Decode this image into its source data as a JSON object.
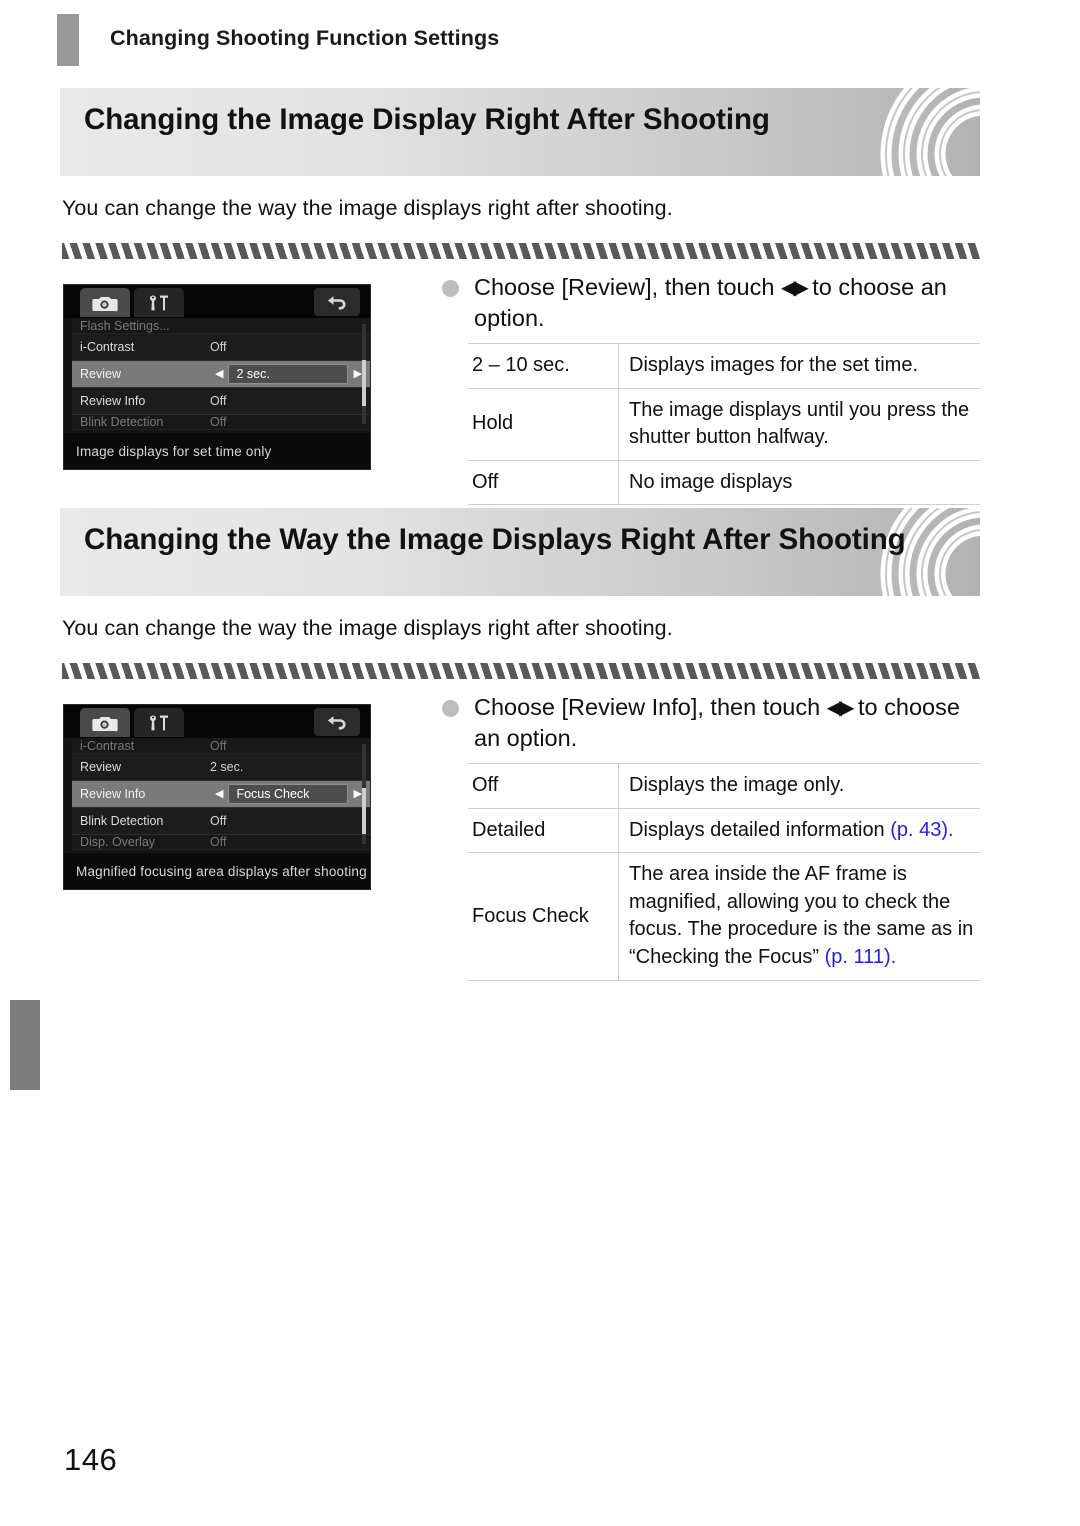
{
  "running_header": {
    "title": "Changing Shooting Function Settings"
  },
  "folio": "146",
  "sections": [
    {
      "band_title": "Changing the Image Display Right After Shooting",
      "intro": "You can change the way the image displays right after shooting.",
      "instruction": {
        "prefix": "Choose [Review], then touch",
        "arrows": "◀▶",
        "suffix": "to choose an option."
      },
      "lcd": {
        "tab_camera_icon": "camera-icon",
        "tab_settings_icon": "wrench-tools-icon",
        "back_icon": "return-arrow-icon",
        "caption": "Image displays for set time only",
        "rows": [
          {
            "label": "Flash Settings...",
            "value": "",
            "state": "clipped"
          },
          {
            "label": "i-Contrast",
            "value": "Off",
            "state": "normal"
          },
          {
            "label": "Review",
            "value": "2 sec.",
            "state": "selected"
          },
          {
            "label": "Review Info",
            "value": "Off",
            "state": "normal"
          },
          {
            "label": "Blink Detection",
            "value": "Off",
            "state": "clipped"
          }
        ]
      },
      "table": {
        "rows": [
          {
            "key": "2 – 10 sec.",
            "value": "Displays images for the set time.",
            "pageref": ""
          },
          {
            "key": "Hold",
            "value": "The image displays until you press the shutter button halfway.",
            "pageref": ""
          },
          {
            "key": "Off",
            "value": "No image displays",
            "pageref": ""
          }
        ]
      }
    },
    {
      "band_title": "Changing the Way the Image Displays Right After Shooting",
      "intro": "You can change the way the image displays right after shooting.",
      "instruction": {
        "prefix": "Choose [Review Info], then touch",
        "arrows": "◀▶",
        "suffix": "to choose an option."
      },
      "lcd": {
        "tab_camera_icon": "camera-icon",
        "tab_settings_icon": "wrench-tools-icon",
        "back_icon": "return-arrow-icon",
        "caption": "Magnified focusing area displays after shooting",
        "rows": [
          {
            "label": "i-Contrast",
            "value": "Off",
            "state": "clipped"
          },
          {
            "label": "Review",
            "value": "2 sec.",
            "state": "normal"
          },
          {
            "label": "Review Info",
            "value": "Focus Check",
            "state": "selected"
          },
          {
            "label": "Blink Detection",
            "value": "Off",
            "state": "normal"
          },
          {
            "label": "Disp. Overlay",
            "value": "Off",
            "state": "clipped"
          }
        ]
      },
      "table": {
        "rows": [
          {
            "key": "Off",
            "value": "Displays the image only.",
            "pageref": ""
          },
          {
            "key": "Detailed",
            "value": "Displays detailed information",
            "pageref": "(p. 43)."
          },
          {
            "key": "Focus Check",
            "value": "The area inside the AF frame is magnified, allowing you to check the focus. The procedure is the same as in “Checking the Focus”",
            "pageref": "(p. 111)."
          }
        ]
      }
    }
  ],
  "colors": {
    "pageref_blue": "#2222dd",
    "band_gradient_start": "#e9e9e9",
    "band_gradient_end": "#b2b2b2",
    "header_bar_gray": "#999999",
    "tab_gray": "#7d7d7d",
    "bullet_gray": "#bdbdbd"
  }
}
